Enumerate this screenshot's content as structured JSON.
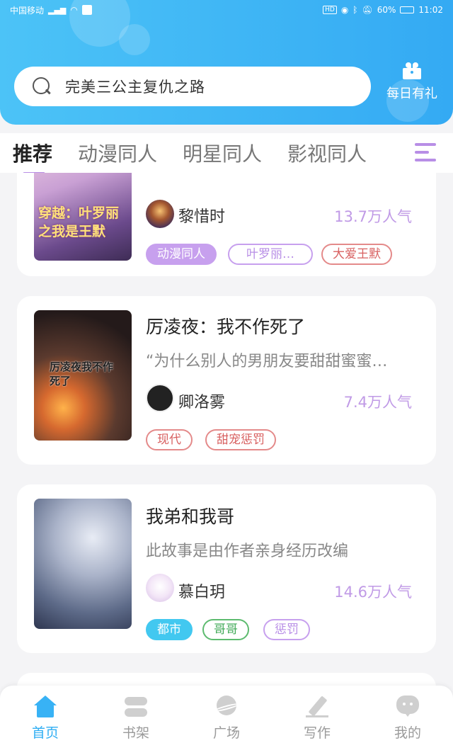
{
  "statusbar": {
    "carrier": "中国移动",
    "battery": "60%",
    "time": "11:02",
    "hd": "HD"
  },
  "search": {
    "placeholder_text": "完美三公主复仇之路"
  },
  "gift": {
    "label": "每日有礼"
  },
  "tabs": [
    {
      "label": "推荐",
      "active": true
    },
    {
      "label": "动漫同人",
      "active": false
    },
    {
      "label": "明星同人",
      "active": false
    },
    {
      "label": "影视同人",
      "active": false
    }
  ],
  "cards": [
    {
      "title": "",
      "desc": "",
      "cover_text": "穿越：叶罗丽之我是王默",
      "author": "黎惜时",
      "popularity": "13.7万人气",
      "tags": [
        {
          "label": "动漫同人",
          "style": "filled-purple"
        },
        {
          "label": "叶罗丽…",
          "style": "outline-purple"
        },
        {
          "label": "大爱王默",
          "style": "outline-red"
        }
      ]
    },
    {
      "title": "厉凌夜：我不作死了",
      "desc": "“为什么别人的男朋友要甜甜蜜蜜…",
      "cover_text": "厉凌夜我不作死了",
      "author": "卿洛雾",
      "popularity": "7.4万人气",
      "tags": [
        {
          "label": "现代",
          "style": "outline-red"
        },
        {
          "label": "甜宠惩罚",
          "style": "outline-red"
        }
      ]
    },
    {
      "title": "我弟和我哥",
      "desc": "此故事是由作者亲身经历改编",
      "cover_text": "",
      "author": "慕白玥",
      "popularity": "14.6万人气",
      "tags": [
        {
          "label": "都市",
          "style": "filled-blue"
        },
        {
          "label": "哥哥",
          "style": "outline-green"
        },
        {
          "label": "惩罚",
          "style": "outline-purple"
        }
      ]
    }
  ],
  "bottomnav": [
    {
      "label": "首页",
      "icon": "home-icon",
      "active": true
    },
    {
      "label": "书架",
      "icon": "bookshelf-icon",
      "active": false
    },
    {
      "label": "广场",
      "icon": "planet-icon",
      "active": false
    },
    {
      "label": "写作",
      "icon": "pen-icon",
      "active": false
    },
    {
      "label": "我的",
      "icon": "chat-face-icon",
      "active": false
    }
  ],
  "colors": {
    "header_blue": "#3aaef4",
    "accent_purple": "#b88ee6",
    "tag_red": "#e07070",
    "tag_green": "#4caf62",
    "tag_blue": "#41c6ef",
    "nav_active": "#2faef3"
  }
}
